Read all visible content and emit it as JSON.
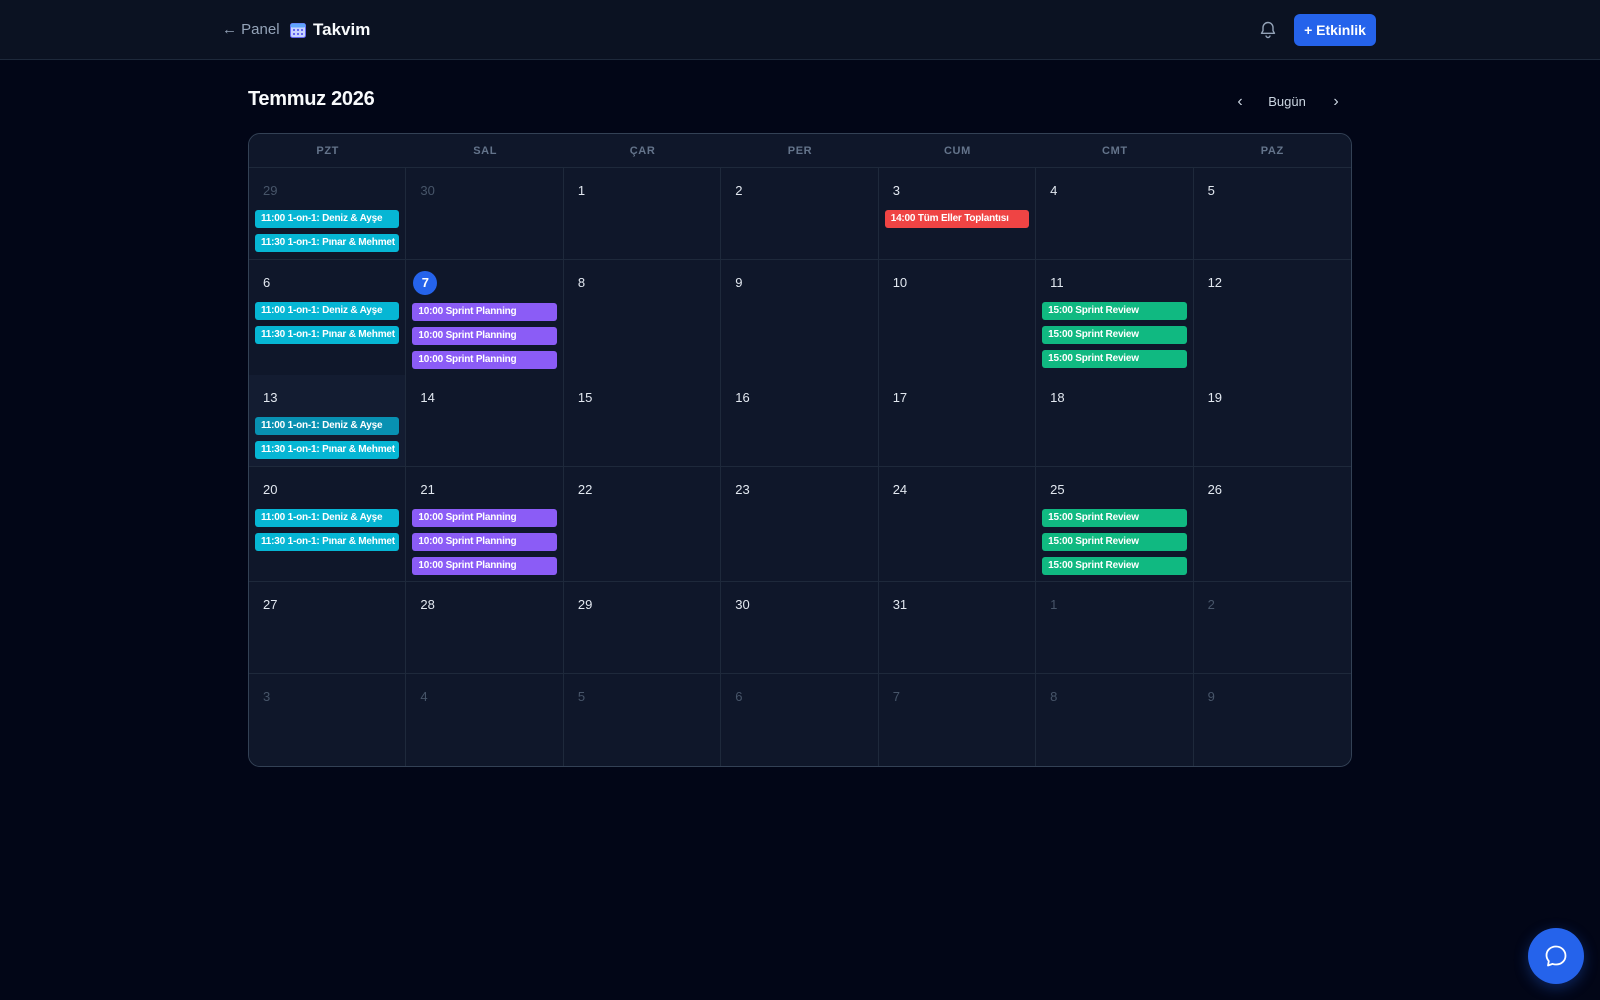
{
  "header": {
    "back_label": "← Panel",
    "title": "Takvim",
    "new_button_label": "+ Etkinlik"
  },
  "month": {
    "title": "Temmuz 2026",
    "prev_label": "‹",
    "next_label": "›",
    "today_label": "Bugün"
  },
  "weekdays": [
    "PZT",
    "SAL",
    "ÇAR",
    "PER",
    "CUM",
    "CMT",
    "PAZ"
  ],
  "colors": {
    "one_on_one": "#06b6d4",
    "sprint_planning": "#8b5cf6",
    "sprint_review": "#10b981",
    "all_hands": "#ef4444",
    "accent": "#2563eb"
  },
  "weeks": [
    {
      "height": 92,
      "days": [
        {
          "num": "29",
          "muted": true,
          "events": [
            {
              "label": "11:00 1-on-1: Deniz & Ayşe",
              "color": "#06b6d4"
            },
            {
              "label": "11:30 1-on-1: Pınar & Mehmet",
              "color": "#06b6d4"
            }
          ]
        },
        {
          "num": "30",
          "muted": true,
          "events": []
        },
        {
          "num": "1",
          "events": []
        },
        {
          "num": "2",
          "events": []
        },
        {
          "num": "3",
          "events": [
            {
              "label": "14:00 Tüm Eller Toplantısı",
              "color": "#ef4444"
            }
          ]
        },
        {
          "num": "4",
          "events": []
        },
        {
          "num": "5",
          "events": []
        }
      ]
    },
    {
      "height": 115,
      "days": [
        {
          "num": "6",
          "events": [
            {
              "label": "11:00 1-on-1: Deniz & Ayşe",
              "color": "#06b6d4"
            },
            {
              "label": "11:30 1-on-1: Pınar & Mehmet",
              "color": "#06b6d4"
            }
          ]
        },
        {
          "num": "7",
          "today": true,
          "events": [
            {
              "label": "10:00 Sprint Planning",
              "color": "#8b5cf6"
            },
            {
              "label": "10:00 Sprint Planning",
              "color": "#8b5cf6"
            },
            {
              "label": "10:00 Sprint Planning",
              "color": "#8b5cf6"
            }
          ]
        },
        {
          "num": "8",
          "events": []
        },
        {
          "num": "9",
          "events": []
        },
        {
          "num": "10",
          "events": []
        },
        {
          "num": "11",
          "events": [
            {
              "label": "15:00 Sprint Review",
              "color": "#10b981"
            },
            {
              "label": "15:00 Sprint Review",
              "color": "#10b981"
            },
            {
              "label": "15:00 Sprint Review",
              "color": "#10b981"
            }
          ]
        },
        {
          "num": "12",
          "events": []
        }
      ]
    },
    {
      "height": 92,
      "days": [
        {
          "num": "13",
          "hover": true,
          "events": [
            {
              "label": "11:00 1-on-1: Deniz & Ayşe",
              "color": "#0891b2"
            },
            {
              "label": "11:30 1-on-1: Pınar & Mehmet",
              "color": "#06b6d4"
            }
          ]
        },
        {
          "num": "14",
          "events": []
        },
        {
          "num": "15",
          "events": []
        },
        {
          "num": "16",
          "events": []
        },
        {
          "num": "17",
          "events": []
        },
        {
          "num": "18",
          "events": []
        },
        {
          "num": "19",
          "events": []
        }
      ]
    },
    {
      "height": 115,
      "days": [
        {
          "num": "20",
          "events": [
            {
              "label": "11:00 1-on-1: Deniz & Ayşe",
              "color": "#06b6d4"
            },
            {
              "label": "11:30 1-on-1: Pınar & Mehmet",
              "color": "#06b6d4"
            }
          ]
        },
        {
          "num": "21",
          "events": [
            {
              "label": "10:00 Sprint Planning",
              "color": "#8b5cf6"
            },
            {
              "label": "10:00 Sprint Planning",
              "color": "#8b5cf6"
            },
            {
              "label": "10:00 Sprint Planning",
              "color": "#8b5cf6"
            }
          ]
        },
        {
          "num": "22",
          "events": []
        },
        {
          "num": "23",
          "events": []
        },
        {
          "num": "24",
          "events": []
        },
        {
          "num": "25",
          "events": [
            {
              "label": "15:00 Sprint Review",
              "color": "#10b981"
            },
            {
              "label": "15:00 Sprint Review",
              "color": "#10b981"
            },
            {
              "label": "15:00 Sprint Review",
              "color": "#10b981"
            }
          ]
        },
        {
          "num": "26",
          "events": []
        }
      ]
    },
    {
      "height": 92,
      "days": [
        {
          "num": "27",
          "events": []
        },
        {
          "num": "28",
          "events": []
        },
        {
          "num": "29",
          "events": []
        },
        {
          "num": "30",
          "events": []
        },
        {
          "num": "31",
          "events": []
        },
        {
          "num": "1",
          "muted": true,
          "events": []
        },
        {
          "num": "2",
          "muted": true,
          "events": []
        }
      ]
    },
    {
      "height": 92,
      "days": [
        {
          "num": "3",
          "muted": true,
          "events": []
        },
        {
          "num": "4",
          "muted": true,
          "events": []
        },
        {
          "num": "5",
          "muted": true,
          "events": []
        },
        {
          "num": "6",
          "muted": true,
          "events": []
        },
        {
          "num": "7",
          "muted": true,
          "events": []
        },
        {
          "num": "8",
          "muted": true,
          "events": []
        },
        {
          "num": "9",
          "muted": true,
          "events": []
        }
      ]
    }
  ]
}
